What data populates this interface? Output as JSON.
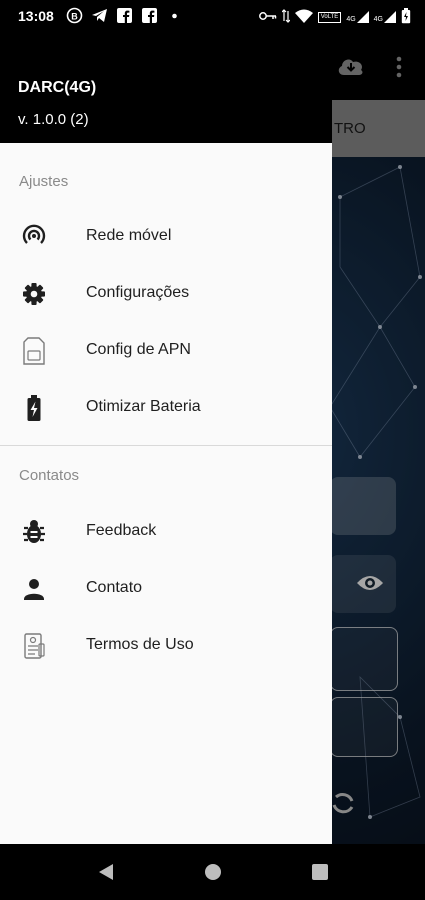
{
  "status_bar": {
    "time": "13:08",
    "left_icons": [
      "b-circle-icon",
      "telegram-icon",
      "facebook-icon",
      "facebook-icon",
      "dot-icon"
    ],
    "right_icons": [
      "vpn-icon",
      "data-arrows-icon",
      "wifi-icon",
      "volte-icon",
      "signal-4g-icon",
      "signal-4g-icon",
      "battery-icon"
    ],
    "volte_label": "VoLTE",
    "net_label_1": "4G",
    "net_label_2": "4G"
  },
  "app": {
    "header_strip_text": "TRO",
    "toolbar_icons": [
      "cloud-download-icon",
      "more-vert-icon"
    ]
  },
  "drawer": {
    "title": "DARC(4G)",
    "version": "v. 1.0.0 (2)",
    "sections": [
      {
        "label": "Ajustes",
        "items": [
          {
            "label": "Rede móvel",
            "icon": "cell-tower-icon"
          },
          {
            "label": "Configurações",
            "icon": "gear-icon"
          },
          {
            "label": "Config de APN",
            "icon": "sim-card-icon"
          },
          {
            "label": "Otimizar Bateria",
            "icon": "battery-charging-icon"
          }
        ]
      },
      {
        "label": "Contatos",
        "items": [
          {
            "label": "Feedback",
            "icon": "bug-icon"
          },
          {
            "label": "Contato",
            "icon": "person-icon"
          },
          {
            "label": "Termos de Uso",
            "icon": "terms-document-icon"
          }
        ]
      }
    ]
  },
  "colors": {
    "drawer_bg": "#fafafa",
    "header_bg": "#000000",
    "text_primary": "#1f1f1f",
    "section_label": "#8a8a8a"
  }
}
